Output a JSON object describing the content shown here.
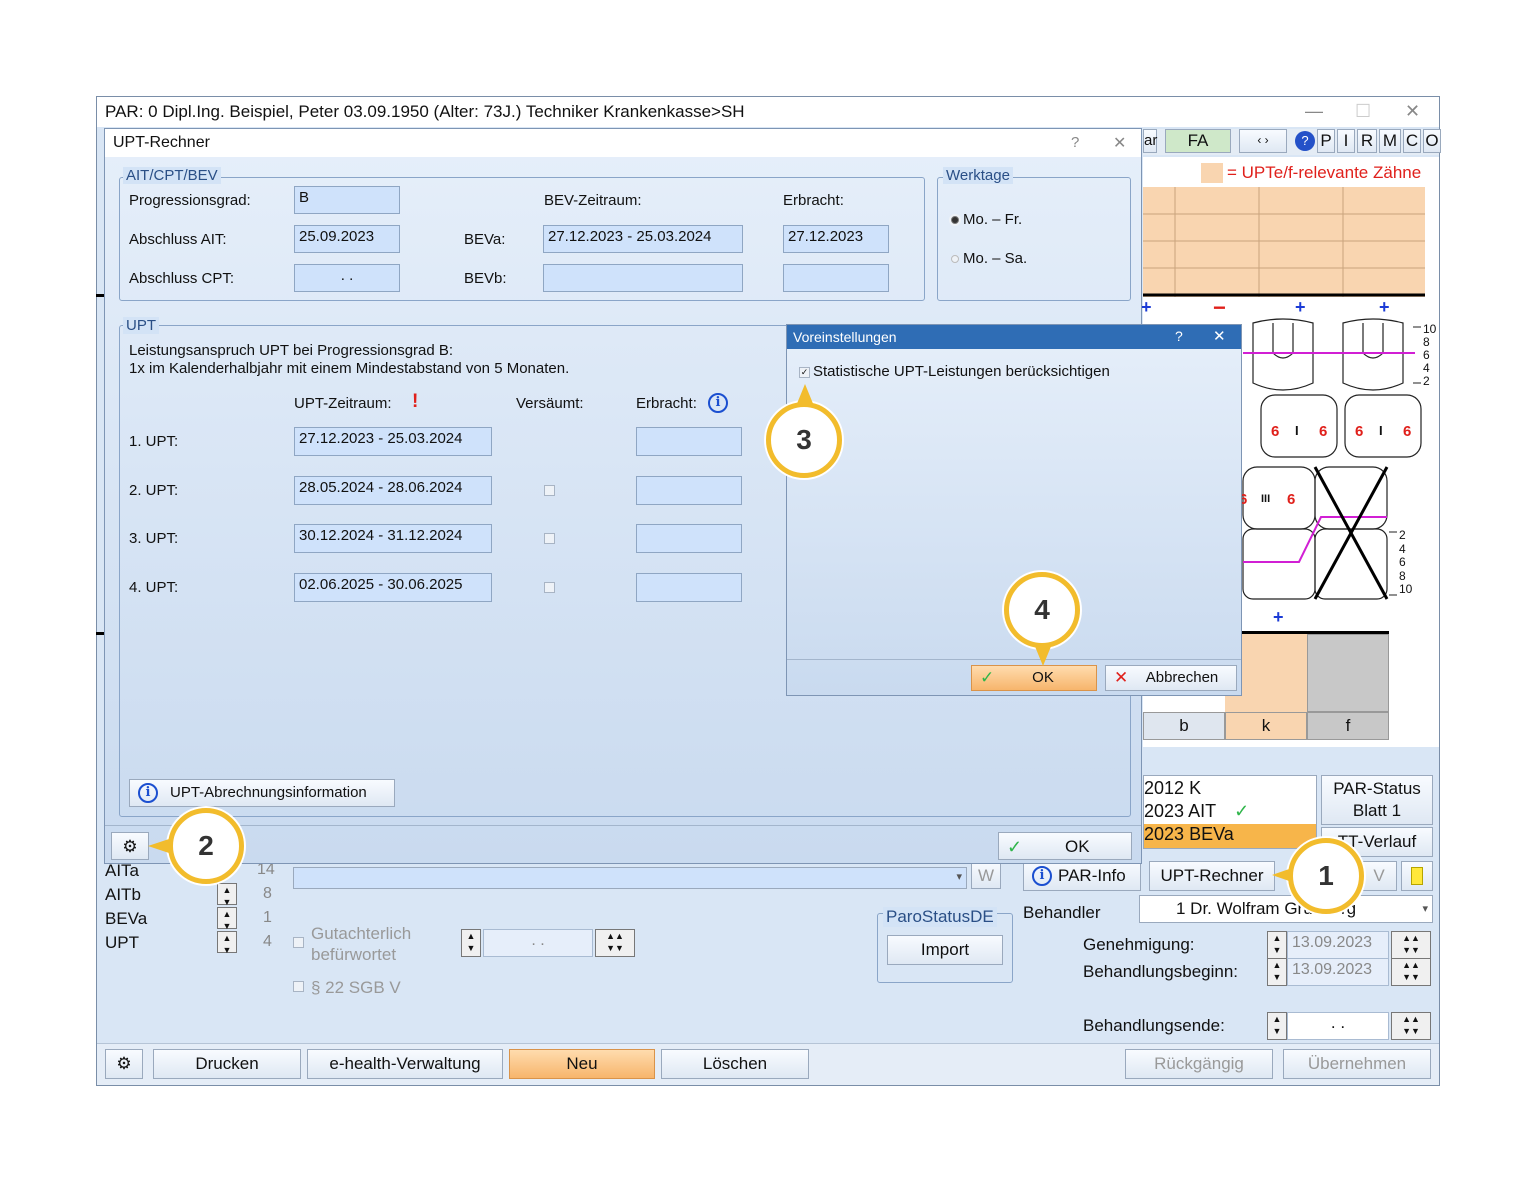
{
  "main_window": {
    "title": "PAR: 0  Dipl.Ing. Beispiel, Peter  03.09.1950 (Alter: 73J.)  Techniker Krankenkasse>SH",
    "toolbar_tabs": [
      "ar",
      "FA"
    ],
    "toolbar_letters": [
      "P",
      "I",
      "R",
      "M",
      "C",
      "O"
    ],
    "legend_text": "= UPTe/f-relevante Zähne",
    "chart_marks": {
      "minus": "−",
      "plus": "+"
    },
    "scale_top": [
      "10",
      "8",
      "6",
      "4",
      "2"
    ],
    "scale_bottom": [
      "2",
      "4",
      "6",
      "8",
      "10"
    ],
    "tooth_numbers": [
      "6",
      "6",
      "6",
      "6",
      "6",
      "6",
      "6"
    ],
    "tooth_symbol_I": "I",
    "tooth_symbol_III": "III",
    "lower_table_headers": [
      "b",
      "k",
      "f"
    ],
    "history_list": [
      {
        "year": "2012",
        "code": "K",
        "check": false,
        "selected": false
      },
      {
        "year": "2023",
        "code": "AIT",
        "check": true,
        "selected": false
      },
      {
        "year": "2023",
        "code": "BEVa",
        "check": false,
        "selected": true
      }
    ],
    "par_status_button": "PAR-Status\nBlatt 1",
    "tt_verlauf_button": "TT-Verlauf",
    "par_info_button": "PAR-Info",
    "upt_rechner_button": "UPT-Rechner",
    "v_button": "V",
    "w_button": "W",
    "behandler_label": "Behandler",
    "behandler_value": "1 Dr. Wolfram Grünberg",
    "genehmigung_label": "Genehmigung:",
    "genehmigung_value": "13.09.2023",
    "behandlungsbeginn_label": "Behandlungsbeginn:",
    "behandlungsbeginn_value": "13.09.2023",
    "behandlungsende_label": "Behandlungsende:",
    "behandlungsende_value": ". .",
    "count_rows": [
      {
        "label": "AITa",
        "value": "14"
      },
      {
        "label": "AITb",
        "value": "8"
      },
      {
        "label": "BEVa",
        "value": "1"
      },
      {
        "label": "UPT",
        "value": "4"
      }
    ],
    "gutachterlich_label": "Gutachterlich\nbefürwortet",
    "sgb_label": "§ 22 SGB V",
    "date_field_value": ". .",
    "parostatus_group": "ParoStatusDE",
    "import_button": "Import",
    "bottom_buttons": {
      "drucken": "Drucken",
      "ehealth": "e-health-Verwaltung",
      "neu": "Neu",
      "loeschen": "Löschen",
      "rueckgaengig": "Rückgängig",
      "uebernehmen": "Übernehmen"
    }
  },
  "upt_dialog": {
    "title": "UPT-Rechner",
    "help": "?",
    "close": "✕",
    "group_ait": "AIT/CPT/BEV",
    "progressionsgrad_label": "Progressionsgrad:",
    "progressionsgrad_value": "B",
    "abschluss_ait_label": "Abschluss AIT:",
    "abschluss_ait_value": "25.09.2023",
    "abschluss_cpt_label": "Abschluss CPT:",
    "abschluss_cpt_value": ". .",
    "bev_zeitraum_label": "BEV-Zeitraum:",
    "beva_label": "BEVa:",
    "beva_value": "27.12.2023 - 25.03.2024",
    "bevb_label": "BEVb:",
    "bevb_value": "",
    "erbracht_label": "Erbracht:",
    "erbracht_value": "27.12.2023",
    "group_werktage": "Werktage",
    "werktage_options": [
      {
        "label": "Mo. – Fr.",
        "selected": true
      },
      {
        "label": "Mo. – Sa.",
        "selected": false
      }
    ],
    "group_upt": "UPT",
    "upt_info_line1": "Leistungsanspruch UPT bei Progressionsgrad B:",
    "upt_info_line2": "1x im Kalenderhalbjahr mit einem Mindestabstand von 5 Monaten.",
    "col_zeitraum": "UPT-Zeitraum:",
    "col_zeitraum_mark": "!",
    "col_versaeumt": "Versäumt:",
    "col_erbracht": "Erbracht:",
    "upt_rows": [
      {
        "label": "1. UPT:",
        "zeitraum": "27.12.2023 - 25.03.2024",
        "has_checkbox": false
      },
      {
        "label": "2. UPT:",
        "zeitraum": "28.05.2024 - 28.06.2024",
        "has_checkbox": true
      },
      {
        "label": "3. UPT:",
        "zeitraum": "30.12.2024 - 31.12.2024",
        "has_checkbox": true
      },
      {
        "label": "4. UPT:",
        "zeitraum": "02.06.2025 - 30.06.2025",
        "has_checkbox": true
      }
    ],
    "abrechnungsinfo_button": "UPT-Abrechnungsinformation",
    "ok_button": "OK"
  },
  "voreinstellungen_dialog": {
    "title": "Voreinstellungen",
    "help": "?",
    "close": "✕",
    "checkbox_label": "Statistische UPT-Leistungen berücksichtigen",
    "checkbox_checked": true,
    "ok_button": "OK",
    "cancel_button": "Abbrechen"
  },
  "callouts": [
    "1",
    "2",
    "3",
    "4"
  ],
  "colors": {
    "callout_ring": "#f2bc2c",
    "accent_orange": "#f7b56c",
    "peach": "#f9d5b0",
    "dialog_blue": "#2f6db5",
    "red": "#e0201b"
  }
}
